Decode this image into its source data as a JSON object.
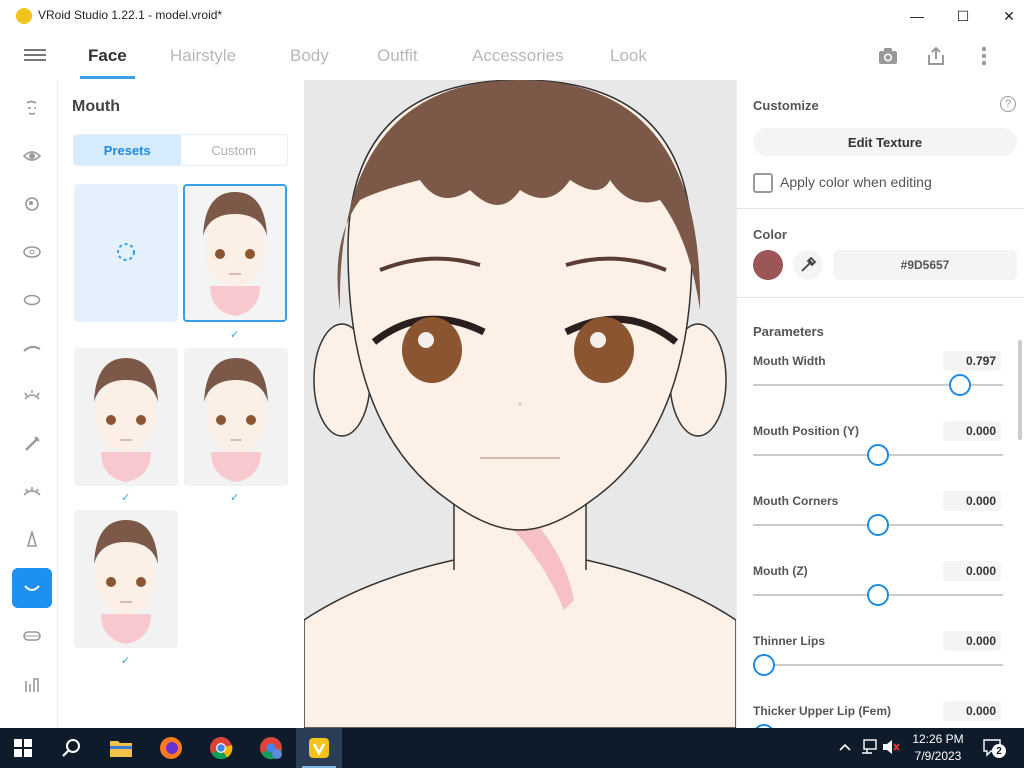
{
  "window": {
    "title": "VRoid Studio 1.22.1 - model.vroid*",
    "minimize": "—",
    "maximize": "☐",
    "close": "✕"
  },
  "nav": {
    "tabs": [
      {
        "label": "Face",
        "active": true
      },
      {
        "label": "Hairstyle",
        "active": false
      },
      {
        "label": "Body",
        "active": false
      },
      {
        "label": "Outfit",
        "active": false
      },
      {
        "label": "Accessories",
        "active": false
      },
      {
        "label": "Look",
        "active": false
      }
    ]
  },
  "rail": {
    "items": [
      "face-outline-icon",
      "eye-icon",
      "iris-icon",
      "eye-white-icon",
      "eye-shape-icon",
      "eyebrow-icon",
      "eyelash-icon",
      "eyeline-icon",
      "eyelid-icon",
      "nose-icon",
      "mouth-icon",
      "teeth-icon",
      "ear-icon"
    ],
    "active_index": 10
  },
  "panel": {
    "title": "Mouth",
    "segments": {
      "presets": "Presets",
      "custom": "Custom"
    },
    "checkmark": "✓"
  },
  "right": {
    "customize": "Customize",
    "help": "?",
    "edit_texture": "Edit Texture",
    "apply_color": "Apply color when editing",
    "color_title": "Color",
    "color_hex": "#9D5657",
    "swatch_color": "#9D5657",
    "params_title": "Parameters",
    "params": [
      {
        "label": "Mouth Width",
        "value": "0.797",
        "fraction": 0.86
      },
      {
        "label": "Mouth Position (Y)",
        "value": "0.000",
        "fraction": 0.5
      },
      {
        "label": "Mouth Corners",
        "value": "0.000",
        "fraction": 0.5
      },
      {
        "label": "Mouth (Z)",
        "value": "0.000",
        "fraction": 0.5
      },
      {
        "label": "Thinner Lips",
        "value": "0.000",
        "fraction": 0.0
      },
      {
        "label": "Thicker Upper Lip (Fem)",
        "value": "0.000",
        "fraction": 0.0
      }
    ]
  },
  "taskbar": {
    "time": "12:26 PM",
    "date": "7/9/2023",
    "notifications": "2"
  },
  "colors": {
    "accent": "#1e90ef",
    "hair": "#7b5848",
    "skin": "#fdf0e6",
    "eye": "#8a5530"
  }
}
